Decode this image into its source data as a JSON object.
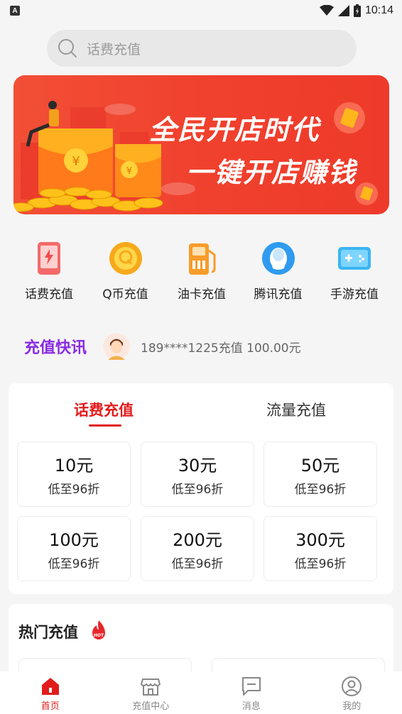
{
  "status_bar": {
    "time": "10:14",
    "notification_icon_text": "A"
  },
  "search": {
    "placeholder": "话费充值"
  },
  "banner": {
    "line1": "全民开店时代",
    "line2": "一键开店赚钱",
    "slide_count": 4,
    "active_slide": 1
  },
  "categories": [
    {
      "label": "话费充值",
      "icon": "phone-icon"
    },
    {
      "label": "Q币充值",
      "icon": "q-coin-icon"
    },
    {
      "label": "油卡充值",
      "icon": "fuel-pump-icon"
    },
    {
      "label": "腾讯充值",
      "icon": "penguin-icon"
    },
    {
      "label": "手游充值",
      "icon": "gamepad-icon"
    }
  ],
  "news": {
    "title": "充值快讯",
    "message": "189****1225充值 100.00元"
  },
  "recharge": {
    "tabs": [
      {
        "label": "话费充值",
        "active": true
      },
      {
        "label": "流量充值",
        "active": false
      }
    ],
    "options": [
      {
        "amount": "10元",
        "discount": "低至96折"
      },
      {
        "amount": "30元",
        "discount": "低至96折"
      },
      {
        "amount": "50元",
        "discount": "低至96折"
      },
      {
        "amount": "100元",
        "discount": "低至96折"
      },
      {
        "amount": "200元",
        "discount": "低至96折"
      },
      {
        "amount": "300元",
        "discount": "低至96折"
      }
    ]
  },
  "hot": {
    "title": "热门充值",
    "badge_text": "HOT"
  },
  "bottom_nav": [
    {
      "label": "首页",
      "icon": "home-icon",
      "active": true
    },
    {
      "label": "充值中心",
      "icon": "store-icon",
      "active": false
    },
    {
      "label": "消息",
      "icon": "message-icon",
      "active": false
    },
    {
      "label": "我的",
      "icon": "user-icon",
      "active": false
    }
  ],
  "colors": {
    "accent": "#e21b1b",
    "news_title": "#8a2be2",
    "banner": "#f0412e"
  }
}
